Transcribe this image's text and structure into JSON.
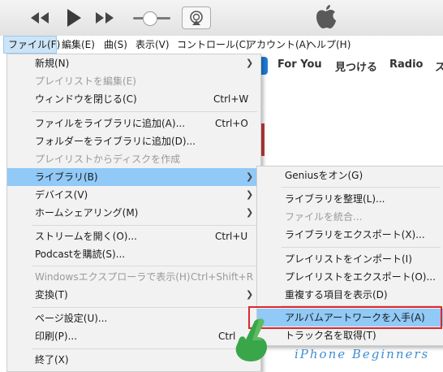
{
  "colors": {
    "highlight": "#91c9f7",
    "callout": "#e0262c",
    "accent": "#1e7ad8",
    "watermark": "#3e8ed4"
  },
  "toolbar": {
    "rewind_icon": "rewind-icon",
    "play_icon": "play-icon",
    "forward_icon": "fast-forward-icon",
    "volume_icon": "volume-slider",
    "airplay_icon": "airplay-icon",
    "logo_icon": "apple-logo-icon"
  },
  "menubar": {
    "items": [
      "ファイル(F)",
      "編集(E)",
      "曲(S)",
      "表示(V)",
      "コントロール(C)",
      "アカウント(A)",
      "ヘルプ(H)"
    ]
  },
  "nav_tabs": [
    "For You",
    "見つける",
    "Radio",
    "ス"
  ],
  "file_menu": {
    "items": [
      {
        "label": "新規(N)",
        "submenu": true
      },
      {
        "label": "プレイリストを編集(E)",
        "disabled": true
      },
      {
        "label": "ウィンドウを閉じる(C)",
        "shortcut": "Ctrl+W"
      },
      {
        "label": "ファイルをライブラリに追加(A)...",
        "shortcut": "Ctrl+O"
      },
      {
        "label": "フォルダーをライブラリに追加(D)..."
      },
      {
        "label": "プレイリストからディスクを作成",
        "disabled": true
      },
      {
        "label": "ライブラリ(B)",
        "submenu": true,
        "highlighted": true
      },
      {
        "label": "デバイス(V)",
        "submenu": true
      },
      {
        "label": "ホームシェアリング(M)",
        "submenu": true
      },
      {
        "label": "ストリームを開く(O)...",
        "shortcut": "Ctrl+U"
      },
      {
        "label": "Podcastを購読(S)..."
      },
      {
        "label": "Windowsエクスプローラで表示(H)",
        "shortcut": "Ctrl+Shift+R",
        "disabled": true
      },
      {
        "label": "変換(T)",
        "submenu": true
      },
      {
        "label": "ページ設定(U)..."
      },
      {
        "label": "印刷(P)...",
        "shortcut": "Ctrl"
      },
      {
        "label": "終了(X)"
      }
    ]
  },
  "library_menu": {
    "items": [
      {
        "label": "Geniusをオン(G)"
      },
      {
        "label": "ライブラリを整理(L)..."
      },
      {
        "label": "ファイルを統合...",
        "disabled": true
      },
      {
        "label": "ライブラリをエクスポート(X)..."
      },
      {
        "label": "プレイリストをインポート(I)"
      },
      {
        "label": "プレイリストをエクスポート(O)..."
      },
      {
        "label": "重複する項目を表示(D)"
      },
      {
        "label": "アルバムアートワークを入手(A)",
        "highlighted": true
      },
      {
        "label": "トラック名を取得(T)"
      }
    ]
  },
  "watermark": "iPhone Beginners"
}
